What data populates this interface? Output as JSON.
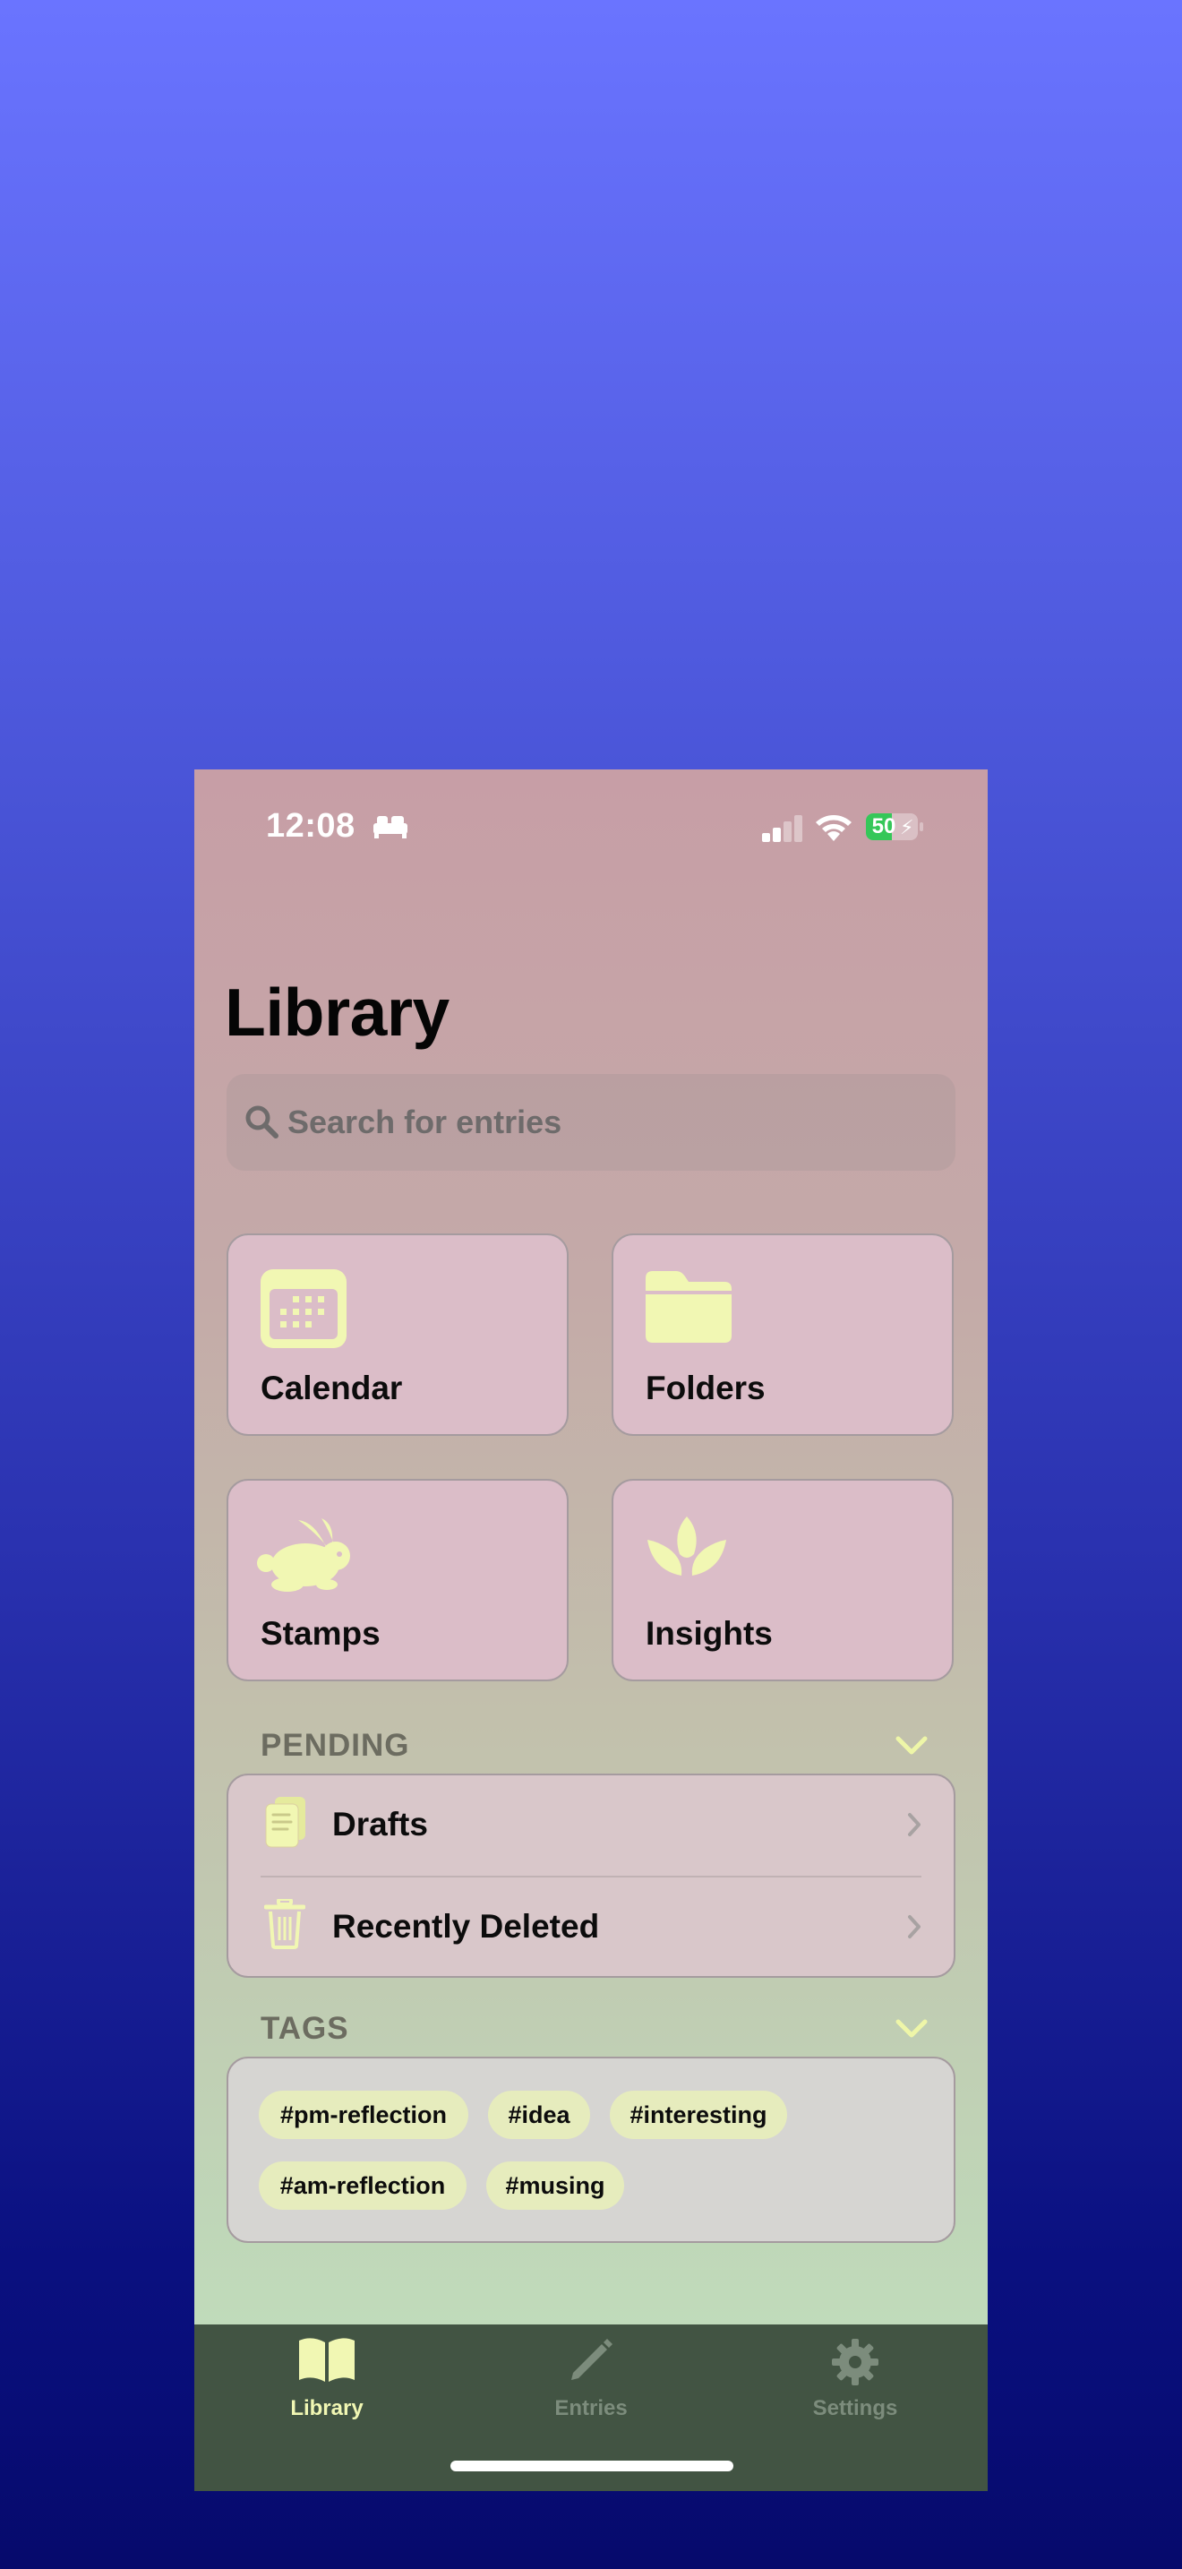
{
  "status_bar": {
    "time": "12:08",
    "battery": "50",
    "battery_level": 0.5
  },
  "page": {
    "title": "Library"
  },
  "search": {
    "placeholder": "Search for entries"
  },
  "tiles": [
    {
      "label": "Calendar",
      "icon": "calendar-icon"
    },
    {
      "label": "Folders",
      "icon": "folder-icon"
    },
    {
      "label": "Stamps",
      "icon": "rabbit-icon"
    },
    {
      "label": "Insights",
      "icon": "lotus-icon"
    }
  ],
  "pending": {
    "header": "PENDING",
    "items": [
      {
        "label": "Drafts",
        "icon": "drafts-icon"
      },
      {
        "label": "Recently Deleted",
        "icon": "trash-icon"
      }
    ]
  },
  "tags": {
    "header": "TAGS",
    "items": [
      "#pm-reflection",
      "#idea",
      "#interesting",
      "#am-reflection",
      "#musing"
    ]
  },
  "tab_bar": {
    "items": [
      {
        "label": "Library",
        "icon": "book-icon",
        "selected": true
      },
      {
        "label": "Entries",
        "icon": "pencil-icon",
        "selected": false
      },
      {
        "label": "Settings",
        "icon": "gear-icon",
        "selected": false
      }
    ]
  },
  "colors": {
    "accent": "#f1f7b3",
    "tab_bar": "#425443",
    "tile_bg": "#dbbdc8",
    "battery_green": "#35c759"
  }
}
